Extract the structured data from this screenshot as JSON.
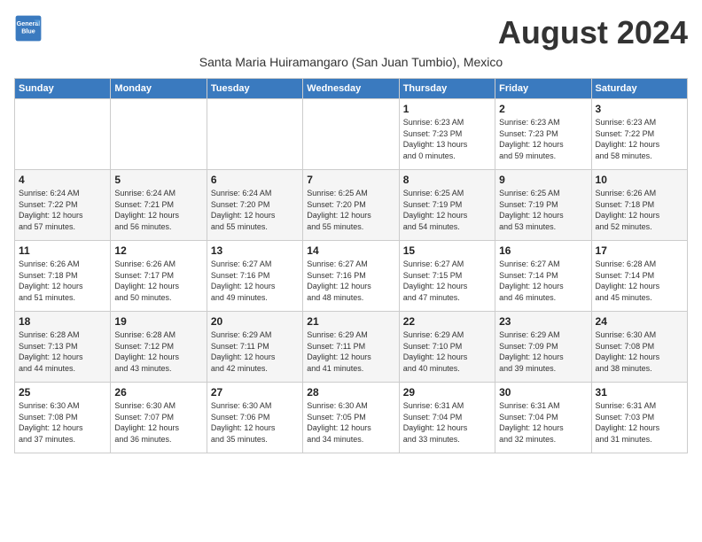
{
  "logo": {
    "line1": "General",
    "line2": "Blue"
  },
  "title": "August 2024",
  "subtitle": "Santa Maria Huiramangaro (San Juan Tumbio), Mexico",
  "header_color": "#3a7abf",
  "days_of_week": [
    "Sunday",
    "Monday",
    "Tuesday",
    "Wednesday",
    "Thursday",
    "Friday",
    "Saturday"
  ],
  "weeks": [
    [
      {
        "day": "",
        "info": ""
      },
      {
        "day": "",
        "info": ""
      },
      {
        "day": "",
        "info": ""
      },
      {
        "day": "",
        "info": ""
      },
      {
        "day": "1",
        "info": "Sunrise: 6:23 AM\nSunset: 7:23 PM\nDaylight: 13 hours\nand 0 minutes."
      },
      {
        "day": "2",
        "info": "Sunrise: 6:23 AM\nSunset: 7:23 PM\nDaylight: 12 hours\nand 59 minutes."
      },
      {
        "day": "3",
        "info": "Sunrise: 6:23 AM\nSunset: 7:22 PM\nDaylight: 12 hours\nand 58 minutes."
      }
    ],
    [
      {
        "day": "4",
        "info": "Sunrise: 6:24 AM\nSunset: 7:22 PM\nDaylight: 12 hours\nand 57 minutes."
      },
      {
        "day": "5",
        "info": "Sunrise: 6:24 AM\nSunset: 7:21 PM\nDaylight: 12 hours\nand 56 minutes."
      },
      {
        "day": "6",
        "info": "Sunrise: 6:24 AM\nSunset: 7:20 PM\nDaylight: 12 hours\nand 55 minutes."
      },
      {
        "day": "7",
        "info": "Sunrise: 6:25 AM\nSunset: 7:20 PM\nDaylight: 12 hours\nand 55 minutes."
      },
      {
        "day": "8",
        "info": "Sunrise: 6:25 AM\nSunset: 7:19 PM\nDaylight: 12 hours\nand 54 minutes."
      },
      {
        "day": "9",
        "info": "Sunrise: 6:25 AM\nSunset: 7:19 PM\nDaylight: 12 hours\nand 53 minutes."
      },
      {
        "day": "10",
        "info": "Sunrise: 6:26 AM\nSunset: 7:18 PM\nDaylight: 12 hours\nand 52 minutes."
      }
    ],
    [
      {
        "day": "11",
        "info": "Sunrise: 6:26 AM\nSunset: 7:18 PM\nDaylight: 12 hours\nand 51 minutes."
      },
      {
        "day": "12",
        "info": "Sunrise: 6:26 AM\nSunset: 7:17 PM\nDaylight: 12 hours\nand 50 minutes."
      },
      {
        "day": "13",
        "info": "Sunrise: 6:27 AM\nSunset: 7:16 PM\nDaylight: 12 hours\nand 49 minutes."
      },
      {
        "day": "14",
        "info": "Sunrise: 6:27 AM\nSunset: 7:16 PM\nDaylight: 12 hours\nand 48 minutes."
      },
      {
        "day": "15",
        "info": "Sunrise: 6:27 AM\nSunset: 7:15 PM\nDaylight: 12 hours\nand 47 minutes."
      },
      {
        "day": "16",
        "info": "Sunrise: 6:27 AM\nSunset: 7:14 PM\nDaylight: 12 hours\nand 46 minutes."
      },
      {
        "day": "17",
        "info": "Sunrise: 6:28 AM\nSunset: 7:14 PM\nDaylight: 12 hours\nand 45 minutes."
      }
    ],
    [
      {
        "day": "18",
        "info": "Sunrise: 6:28 AM\nSunset: 7:13 PM\nDaylight: 12 hours\nand 44 minutes."
      },
      {
        "day": "19",
        "info": "Sunrise: 6:28 AM\nSunset: 7:12 PM\nDaylight: 12 hours\nand 43 minutes."
      },
      {
        "day": "20",
        "info": "Sunrise: 6:29 AM\nSunset: 7:11 PM\nDaylight: 12 hours\nand 42 minutes."
      },
      {
        "day": "21",
        "info": "Sunrise: 6:29 AM\nSunset: 7:11 PM\nDaylight: 12 hours\nand 41 minutes."
      },
      {
        "day": "22",
        "info": "Sunrise: 6:29 AM\nSunset: 7:10 PM\nDaylight: 12 hours\nand 40 minutes."
      },
      {
        "day": "23",
        "info": "Sunrise: 6:29 AM\nSunset: 7:09 PM\nDaylight: 12 hours\nand 39 minutes."
      },
      {
        "day": "24",
        "info": "Sunrise: 6:30 AM\nSunset: 7:08 PM\nDaylight: 12 hours\nand 38 minutes."
      }
    ],
    [
      {
        "day": "25",
        "info": "Sunrise: 6:30 AM\nSunset: 7:08 PM\nDaylight: 12 hours\nand 37 minutes."
      },
      {
        "day": "26",
        "info": "Sunrise: 6:30 AM\nSunset: 7:07 PM\nDaylight: 12 hours\nand 36 minutes."
      },
      {
        "day": "27",
        "info": "Sunrise: 6:30 AM\nSunset: 7:06 PM\nDaylight: 12 hours\nand 35 minutes."
      },
      {
        "day": "28",
        "info": "Sunrise: 6:30 AM\nSunset: 7:05 PM\nDaylight: 12 hours\nand 34 minutes."
      },
      {
        "day": "29",
        "info": "Sunrise: 6:31 AM\nSunset: 7:04 PM\nDaylight: 12 hours\nand 33 minutes."
      },
      {
        "day": "30",
        "info": "Sunrise: 6:31 AM\nSunset: 7:04 PM\nDaylight: 12 hours\nand 32 minutes."
      },
      {
        "day": "31",
        "info": "Sunrise: 6:31 AM\nSunset: 7:03 PM\nDaylight: 12 hours\nand 31 minutes."
      }
    ]
  ]
}
